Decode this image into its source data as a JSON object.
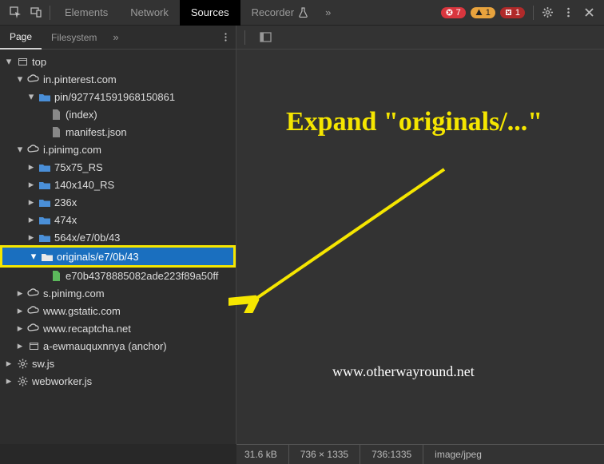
{
  "toolbar": {
    "tabs": [
      "Elements",
      "Network",
      "Sources",
      "Recorder"
    ],
    "active_tab": "Sources",
    "badges": {
      "err": "7",
      "warn": "1",
      "crit": "1"
    }
  },
  "sub_tabs": {
    "items": [
      "Page",
      "Filesystem"
    ],
    "active": "Page"
  },
  "tree": {
    "top": "top",
    "pin_host": "in.pinterest.com",
    "pin_folder": "pin/927741591968150861",
    "pin_index": "(index)",
    "manifest": "manifest.json",
    "img_host": "i.pinimg.com",
    "f_75": "75x75_RS",
    "f_140": "140x140_RS",
    "f_236": "236x",
    "f_474": "474x",
    "f_564": "564x/e7/0b/43",
    "f_orig": "originals/e7/0b/43",
    "orig_file": "e70b4378885082ade223f89a50ff",
    "s_host": "s.pinimg.com",
    "gstatic": "www.gstatic.com",
    "recaptcha": "www.recaptcha.net",
    "anchor": "a-ewmauquxnnya (anchor)",
    "sw": "sw.js",
    "webworker": "webworker.js"
  },
  "annotation": {
    "text": "Expand \"originals/...\""
  },
  "watermark": "www.otherwayround.net",
  "status": {
    "size": "31.6 kB",
    "dims": "736 × 1335",
    "ratio": "736:1335",
    "mime": "image/jpeg"
  },
  "icons": {
    "inspect": "",
    "device": "",
    "flask": "",
    "more": "",
    "gear": "",
    "close": "",
    "dock": ""
  }
}
